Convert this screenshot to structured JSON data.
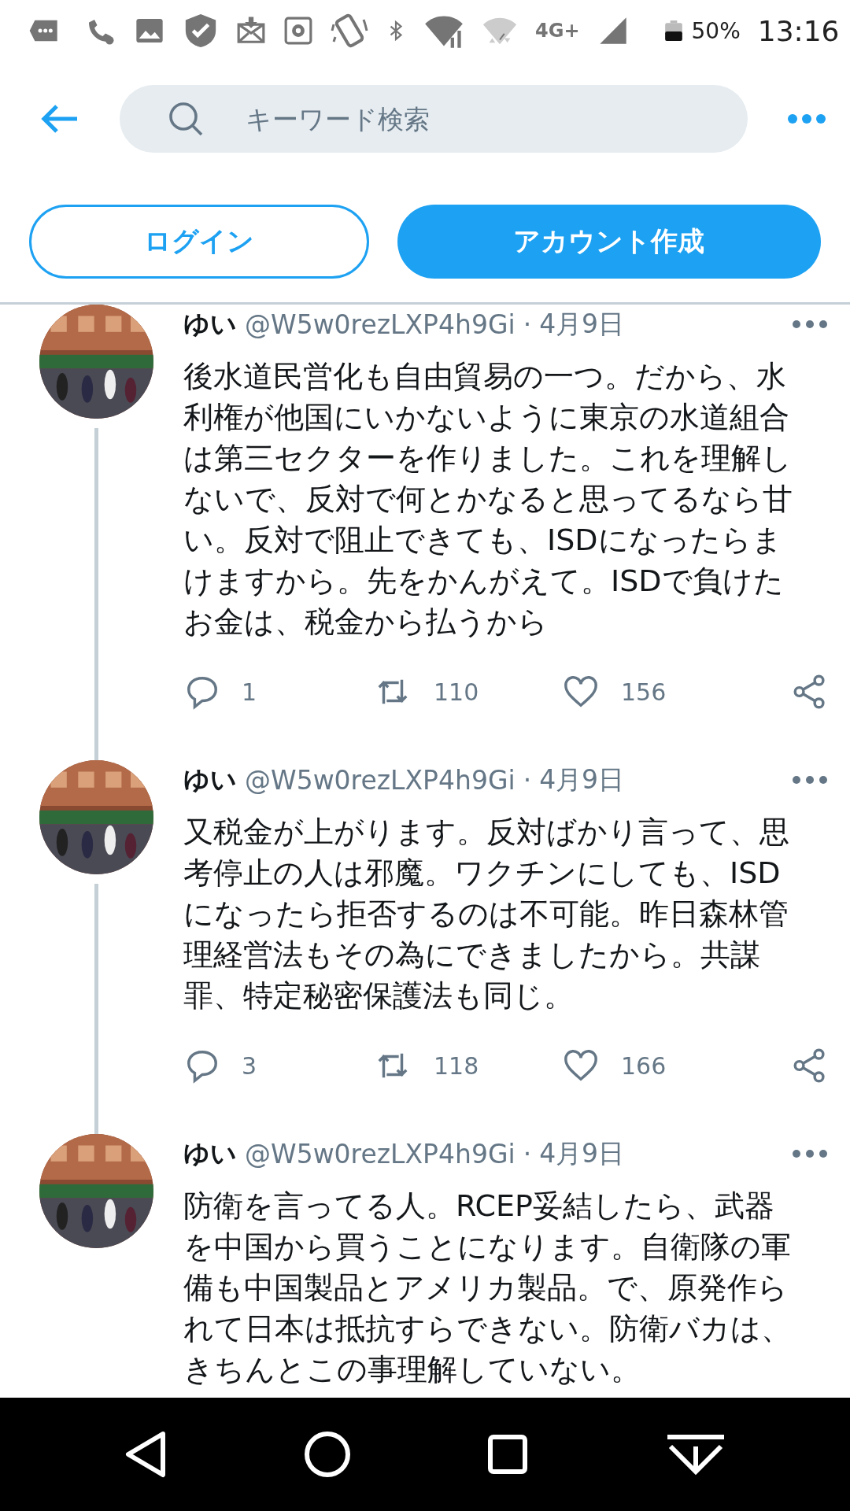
{
  "status_bar": {
    "network": "4G+",
    "battery": "50%",
    "time": "13:16"
  },
  "search": {
    "placeholder": "キーワード検索"
  },
  "buttons": [
    {
      "label": "ログイン",
      "kind": "outline"
    },
    {
      "label": "アカウント作成",
      "kind": "filled"
    }
  ],
  "tweets": [
    {
      "name": "ゆい",
      "handle": "@W5w0rezLXP4h9Gi",
      "dot": "·",
      "date": "4月9日",
      "text": "後水道民営化も自由貿易の一つ。だから、水利権が他国にいかないように東京の水道組合は第三セクターを作りました。これを理解しないで、反対で何とかなると思ってるなら甘い。反対で阻止できても、ISDになったらまけますから。先をかんがえて。ISDで負けたお金は、税金から払うから",
      "replies": "1",
      "retweets": "110",
      "likes": "156",
      "thread_below": true
    },
    {
      "name": "ゆい",
      "handle": "@W5w0rezLXP4h9Gi",
      "dot": "·",
      "date": "4月9日",
      "text": "又税金が上がります。反対ばかり言って、思考停止の人は邪魔。ワクチンにしても、ISDになったら拒否するのは不可能。昨日森林管理経営法もその為にできましたから。共謀罪、特定秘密保護法も同じ。",
      "replies": "3",
      "retweets": "118",
      "likes": "166",
      "thread_below": true
    },
    {
      "name": "ゆい",
      "handle": "@W5w0rezLXP4h9Gi",
      "dot": "·",
      "date": "4月9日",
      "text": "防衛を言ってる人。RCEP妥結したら、武器を中国から買うことになります。自衛隊の軍備も中国製品とアメリカ製品。で、原発作られて日本は抵抗すらできない。防衛バカは、きちんとこの事理解していない。",
      "thread_below": false
    }
  ]
}
